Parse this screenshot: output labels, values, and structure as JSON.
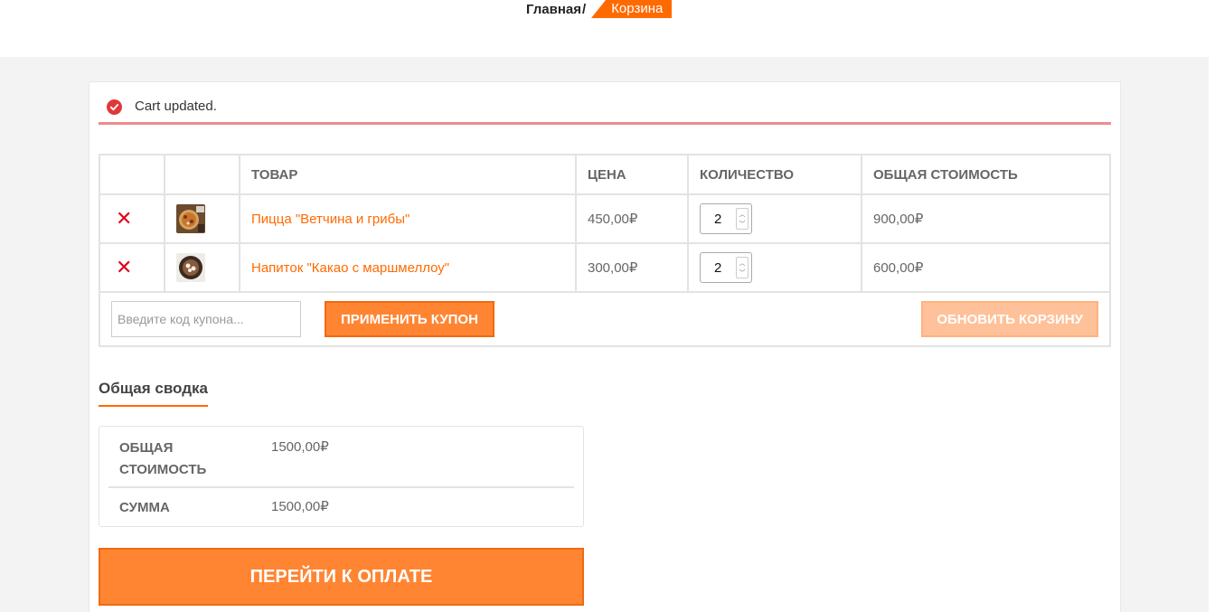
{
  "breadcrumb": {
    "home": "Главная",
    "separator": "/",
    "current": "Корзина"
  },
  "notice": {
    "text": "Cart updated.",
    "icon": "check-circle-icon",
    "color": "#e0383a"
  },
  "cart": {
    "columns": [
      "",
      "",
      "Товар",
      "Цена",
      "Количество",
      "Общая стоимость"
    ],
    "items": [
      {
        "name": "Пицца \"Ветчина и грибы\"",
        "price": "450,00₽",
        "quantity": "2",
        "subtotal": "900,00₽",
        "thumb": "pizza-thumbnail"
      },
      {
        "name": "Напиток \"Какао с маршмеллоу\"",
        "price": "300,00₽",
        "quantity": "2",
        "subtotal": "600,00₽",
        "thumb": "cocoa-thumbnail"
      }
    ],
    "coupon_placeholder": "Введите код купона...",
    "apply_coupon": "Применить купон",
    "update_cart": "Обновить корзину"
  },
  "totals": {
    "title": "Общая сводка",
    "subtotal_label": "Общая стоимость",
    "subtotal_value": "1500,00₽",
    "total_label": "Сумма",
    "total_value": "1500,00₽"
  },
  "checkout": {
    "label": "Перейти к оплате"
  },
  "colors": {
    "accent": "#ff6a00",
    "button": "#ff8533",
    "remove": "#e2001a",
    "notice_border": "#ef8b8b"
  }
}
